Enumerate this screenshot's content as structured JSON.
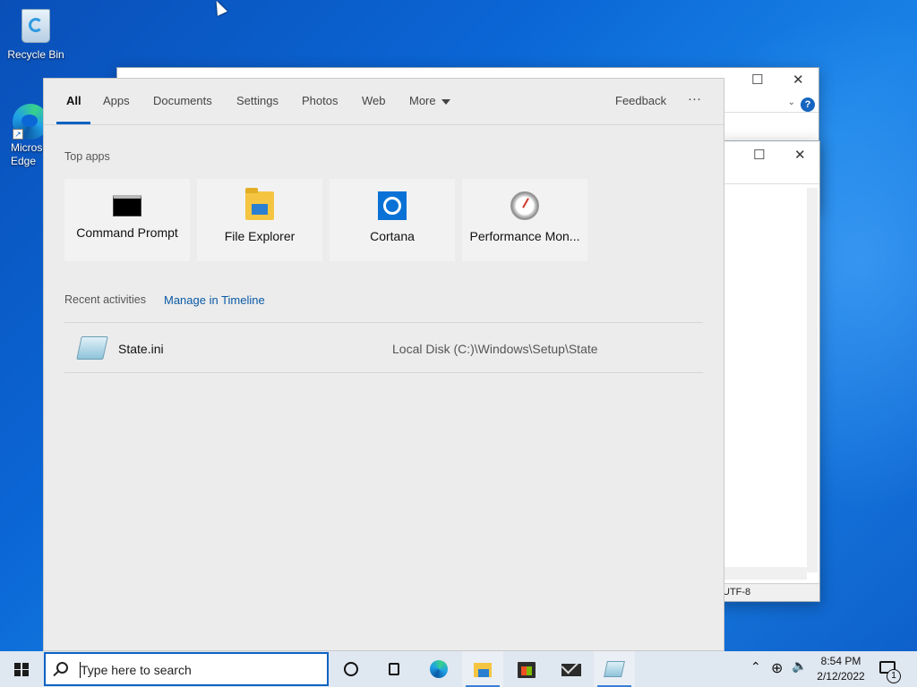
{
  "desktop": {
    "icons": [
      {
        "label": "Recycle Bin"
      },
      {
        "label": "Microsoft Edge"
      }
    ]
  },
  "background_windows": {
    "notepad_status": "UTF-8",
    "minimize_glyph": "☐",
    "close_glyph": "✕",
    "help_glyph": "?",
    "chevron_glyph": "⌄"
  },
  "search_flyout": {
    "tabs": [
      {
        "label": "All",
        "active": true
      },
      {
        "label": "Apps"
      },
      {
        "label": "Documents"
      },
      {
        "label": "Settings"
      },
      {
        "label": "Photos"
      },
      {
        "label": "Web"
      },
      {
        "label": "More"
      }
    ],
    "feedback_label": "Feedback",
    "overflow_label": "···",
    "top_apps_heading": "Top apps",
    "top_apps": [
      {
        "name": "Command Prompt",
        "icon": "command-prompt-icon"
      },
      {
        "name": "File Explorer",
        "icon": "file-explorer-icon"
      },
      {
        "name": "Cortana",
        "icon": "cortana-icon"
      },
      {
        "name": "Performance Mon...",
        "icon": "performance-monitor-icon"
      }
    ],
    "recent_heading": "Recent activities",
    "manage_timeline_label": "Manage in Timeline",
    "recent_items": [
      {
        "name": "State.ini",
        "path": "Local Disk (C:)\\Windows\\Setup\\State",
        "icon": "ini-file-icon"
      }
    ]
  },
  "taskbar": {
    "search_placeholder": "Type here to search",
    "pinned": [
      {
        "name": "cortana-icon"
      },
      {
        "name": "task-view-icon"
      },
      {
        "name": "edge-icon"
      },
      {
        "name": "file-explorer-icon",
        "running": true
      },
      {
        "name": "store-icon"
      },
      {
        "name": "mail-icon"
      },
      {
        "name": "notepad-icon",
        "running": true
      }
    ],
    "tray": {
      "chevron": "⌃",
      "network_glyph": "⊕",
      "volume_glyph": "🔈",
      "time": "8:54 PM",
      "date": "2/12/2022",
      "notification_count": "1"
    }
  },
  "colors": {
    "accent": "#0a62c2",
    "link": "#0a5aa6",
    "flyout_bg": "#ececec",
    "taskbar_bg": "#dfe7f0"
  }
}
